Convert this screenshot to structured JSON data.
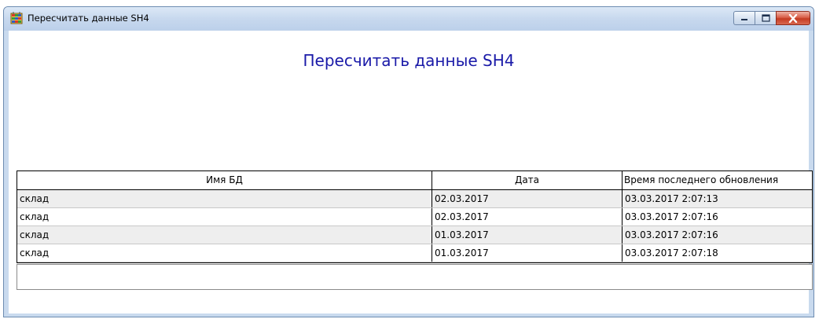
{
  "window": {
    "title": "Пересчитать данные SH4",
    "icon": "grid-app-icon",
    "controls": [
      "minimize-icon",
      "maximize-icon",
      "close-icon"
    ]
  },
  "page": {
    "heading": "Пересчитать данные SH4"
  },
  "table": {
    "columns": [
      "Имя БД",
      "Дата",
      "Время последнего обновления"
    ],
    "rows": [
      [
        "склад",
        "02.03.2017",
        "03.03.2017 2:07:13"
      ],
      [
        "склад",
        "02.03.2017",
        "03.03.2017 2:07:16"
      ],
      [
        "склад",
        "01.03.2017",
        "03.03.2017 2:07:16"
      ],
      [
        "склад",
        "01.03.2017",
        "03.03.2017 2:07:18"
      ]
    ]
  },
  "colors": {
    "heading": "#1a1aa8",
    "alt_row": "#eeeeee",
    "title_bar": "#c7d8ee",
    "close_button": "#c43c23"
  }
}
